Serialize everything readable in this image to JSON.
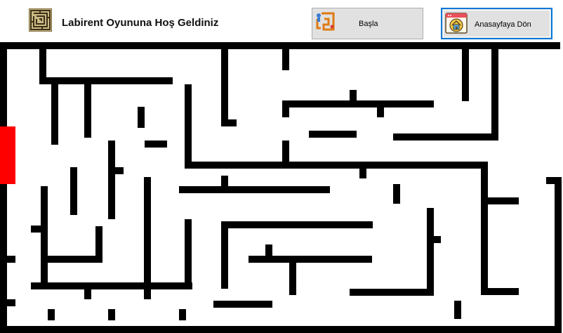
{
  "header": {
    "title": "Labirent Oyununa Hoş Geldiniz",
    "logo_icon": "maze-icon"
  },
  "buttons": {
    "start": {
      "label": "Başla",
      "icon": "maze-path-icon"
    },
    "home": {
      "label": "Anasayfaya Dön",
      "icon": "home-window-icon"
    }
  },
  "colors": {
    "wall": "#000000",
    "goal": "#ff0000",
    "focus_border": "#0078d7"
  }
}
